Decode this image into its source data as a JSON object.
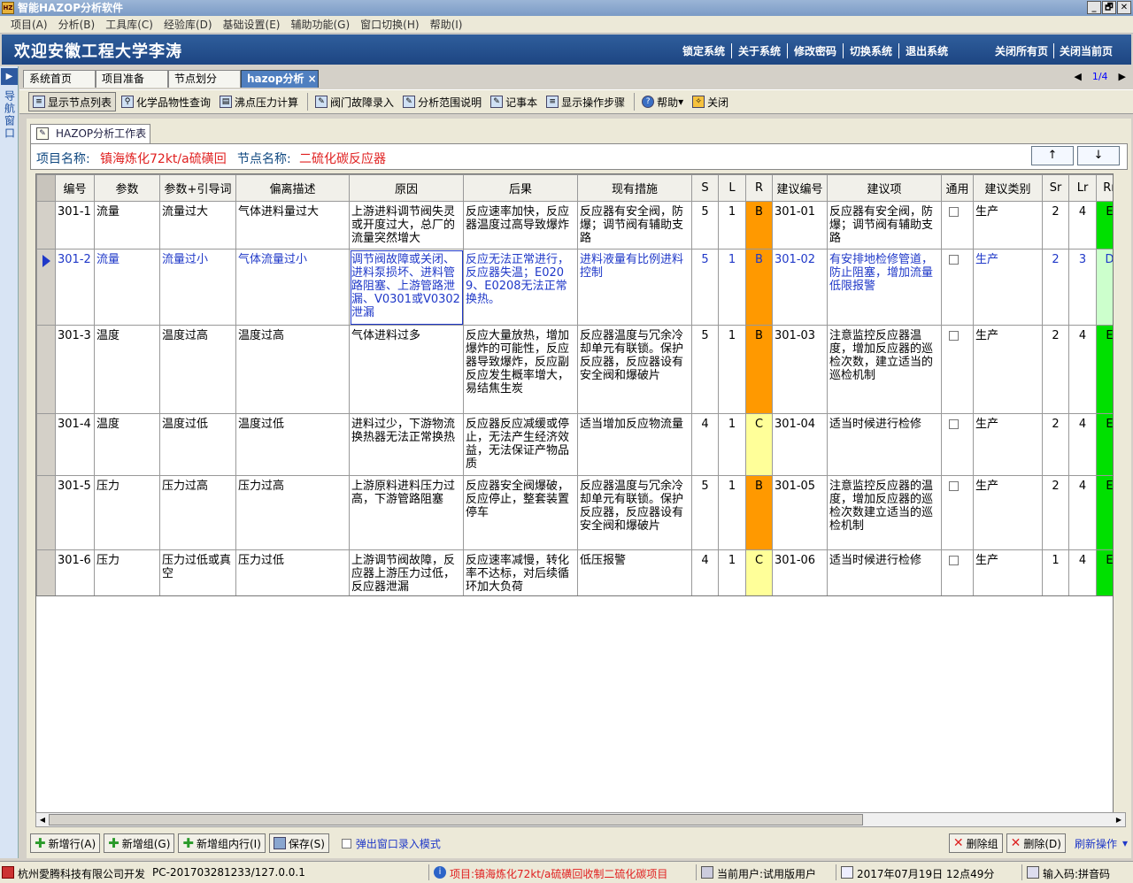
{
  "window": {
    "title": "智能HAZOP分析软件",
    "controls": [
      "_",
      "🗗",
      "✕"
    ]
  },
  "menu": [
    "项目(A)",
    "分析(B)",
    "工具库(C)",
    "经验库(D)",
    "基础设置(E)",
    "辅助功能(G)",
    "窗口切换(H)",
    "帮助(I)"
  ],
  "banner": {
    "welcome": "欢迎安徽工程大学李涛",
    "links": [
      "锁定系统",
      "关于系统",
      "修改密码",
      "切换系统",
      "退出系统"
    ],
    "close_links": [
      "关闭所有页",
      "关闭当前页"
    ]
  },
  "nav": {
    "label": "导航窗口"
  },
  "tabs": [
    {
      "label": "系统首页"
    },
    {
      "label": "项目准备"
    },
    {
      "label": "节点划分"
    },
    {
      "label": "hazop分析"
    }
  ],
  "pager": {
    "prev": "◀",
    "page": "1/4",
    "next": "▶"
  },
  "toolbar": [
    {
      "label": "显示节点列表",
      "icon": "list-icon"
    },
    {
      "label": "化学品物性查询",
      "icon": "search-icon"
    },
    {
      "label": "沸点压力计算",
      "icon": "doc-icon"
    },
    {
      "label": "阀门故障录入",
      "icon": "edit-icon"
    },
    {
      "label": "分析范围说明",
      "icon": "edit-icon"
    },
    {
      "label": "记事本",
      "icon": "edit-icon"
    },
    {
      "label": "显示操作步骤",
      "icon": "list-icon"
    },
    {
      "label": "帮助",
      "icon": "help-icon"
    },
    {
      "label": "关闭",
      "icon": "close-icon"
    }
  ],
  "worktab": {
    "label": "HAZOP分析工作表"
  },
  "info": {
    "project_label": "项目名称:",
    "project_value": "镇海炼化72kt/a硫磺回",
    "node_label": "节点名称:",
    "node_value": "二硫化碳反应器",
    "up": "↑",
    "down": "↓"
  },
  "colors": {
    "B": "#ff9900",
    "C": "#ffff99",
    "E": "#00e000",
    "D": "#ccffcc"
  },
  "table": {
    "headers": [
      "编号",
      "参数",
      "参数+引导词",
      "偏离描述",
      "原因",
      "后果",
      "现有措施",
      "S",
      "L",
      "R",
      "建议编号",
      "建议项",
      "通用",
      "建议类别",
      "Sr",
      "Lr",
      "Rr"
    ],
    "rows": [
      {
        "id": "301-1",
        "param": "流量",
        "guide": "流量过大",
        "dev": "气体进料量过大",
        "cause": "上游进料调节阀失灵或开度过大，总厂的流量突然增大",
        "conseq": "反应速率加快，反应器温度过高导致爆炸",
        "measure": "反应器有安全阀，防爆；调节阀有辅助支路",
        "S": "5",
        "L": "1",
        "R": "B",
        "sid": "301-01",
        "sug": "反应器有安全阀，防爆；调节阀有辅助支路",
        "cat": "生产",
        "Sr": "2",
        "Lr": "4",
        "Rr": "E"
      },
      {
        "id": "301-2",
        "param": "流量",
        "guide": "流量过小",
        "dev": "气体流量过小",
        "cause": "调节阀故障或关闭、进料泵损坏、进料管路阻塞、上游管路泄漏、V0301或V0302泄漏",
        "conseq": "反应无法正常进行，反应器失温；E0209、E0208无法正常换热。",
        "measure": "进料液量有比例进料控制",
        "S": "5",
        "L": "1",
        "R": "B",
        "sid": "301-02",
        "sug": "有安排地检修管道，防止阻塞，增加流量低限报警",
        "cat": "生产",
        "Sr": "2",
        "Lr": "3",
        "Rr": "D"
      },
      {
        "id": "301-3",
        "param": "温度",
        "guide": "温度过高",
        "dev": "温度过高",
        "cause": "气体进料过多",
        "conseq": "反应大量放热，增加爆炸的可能性，反应器导致爆炸，反应副反应发生概率增大，易结焦生炭",
        "measure": "反应器温度与冗余冷却单元有联锁。保护反应器，反应器设有安全阀和爆破片",
        "S": "5",
        "L": "1",
        "R": "B",
        "sid": "301-03",
        "sug": "注意监控反应器温度，增加反应器的巡检次数，建立适当的巡检机制",
        "cat": "生产",
        "Sr": "2",
        "Lr": "4",
        "Rr": "E"
      },
      {
        "id": "301-4",
        "param": "温度",
        "guide": "温度过低",
        "dev": "温度过低",
        "cause": "进料过少，下游物流换热器无法正常换热",
        "conseq": "反应器反应减缓或停止，无法产生经济效益，无法保证产物品质",
        "measure": "适当增加反应物流量",
        "S": "4",
        "L": "1",
        "R": "C",
        "sid": "301-04",
        "sug": "适当时候进行检修",
        "cat": "生产",
        "Sr": "2",
        "Lr": "4",
        "Rr": "E"
      },
      {
        "id": "301-5",
        "param": "压力",
        "guide": "压力过高",
        "dev": "压力过高",
        "cause": "上游原料进料压力过高，下游管路阻塞",
        "conseq": "反应器安全阀爆破，反应停止，整套装置停车",
        "measure": "反应器温度与冗余冷却单元有联锁。保护反应器，反应器设有安全阀和爆破片",
        "S": "5",
        "L": "1",
        "R": "B",
        "sid": "301-05",
        "sug": "注意监控反应器的温度，增加反应器的巡检次数建立适当的巡检机制",
        "cat": "生产",
        "Sr": "2",
        "Lr": "4",
        "Rr": "E"
      },
      {
        "id": "301-6",
        "param": "压力",
        "guide": "压力过低或真空",
        "dev": "压力过低",
        "cause": "上游调节阀故障，反应器上游压力过低，反应器泄漏",
        "conseq": "反应速率减慢，转化率不达标，对后续循环加大负荷",
        "measure": "低压报警",
        "S": "4",
        "L": "1",
        "R": "C",
        "sid": "301-06",
        "sug": "适当时候进行检修",
        "cat": "生产",
        "Sr": "1",
        "Lr": "4",
        "Rr": "E"
      }
    ]
  },
  "bottom": {
    "add_row": "新增行(A)",
    "add_group": "新增组(G)",
    "add_in_group": "新增组内行(I)",
    "save": "保存(S)",
    "popup": "弹出窗口录入模式",
    "del_group": "删除组",
    "del": "删除(D)",
    "refresh": "刷新操作"
  },
  "status": {
    "company": "杭州愛腾科技有限公司开发",
    "host": "PC-201703281233/127.0.0.1",
    "project": "项目:镇海炼化72kt/a硫磺回收制二硫化碳项目",
    "user": "当前用户:试用版用户",
    "time": "2017年07月19日 12点49分",
    "ime": "输入码:拼音码"
  }
}
